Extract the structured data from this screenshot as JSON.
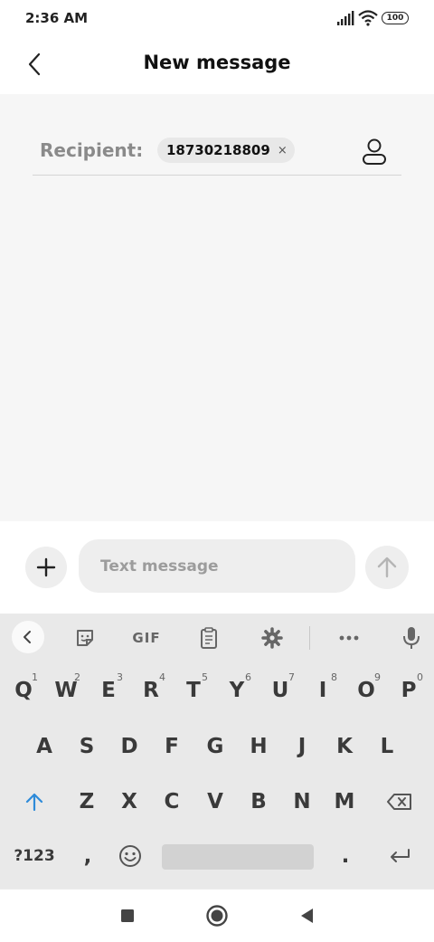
{
  "status_bar": {
    "time": "2:36 AM",
    "battery": "100",
    "icons": [
      "signal-icon",
      "wifi-icon",
      "battery-icon"
    ]
  },
  "header": {
    "title": "New message",
    "back_icon": "chevron-left-icon"
  },
  "recipient": {
    "label": "Recipient:",
    "chip_number": "18730218809",
    "chip_remove": "×",
    "contact_icon": "person-icon"
  },
  "compose": {
    "placeholder": "Text message",
    "value": "",
    "add_icon": "plus-icon",
    "send_icon": "arrow-up-icon"
  },
  "keyboard": {
    "toolbar": {
      "collapse_icon": "chevron-left-icon",
      "sticker_icon": "sticker-icon",
      "gif_label": "GIF",
      "clipboard_icon": "clipboard-icon",
      "settings_icon": "gear-icon",
      "more_icon": "more-icon",
      "mic_icon": "mic-icon"
    },
    "row1": [
      {
        "key": "Q",
        "sup": "1"
      },
      {
        "key": "W",
        "sup": "2"
      },
      {
        "key": "E",
        "sup": "3"
      },
      {
        "key": "R",
        "sup": "4"
      },
      {
        "key": "T",
        "sup": "5"
      },
      {
        "key": "Y",
        "sup": "6"
      },
      {
        "key": "U",
        "sup": "7"
      },
      {
        "key": "I",
        "sup": "8"
      },
      {
        "key": "O",
        "sup": "9"
      },
      {
        "key": "P",
        "sup": "0"
      }
    ],
    "row2": [
      "A",
      "S",
      "D",
      "F",
      "G",
      "H",
      "J",
      "K",
      "L"
    ],
    "row3": [
      "Z",
      "X",
      "C",
      "V",
      "B",
      "N",
      "M"
    ],
    "symbols_label": "?123",
    "comma": ",",
    "period": ".",
    "emoji_icon": "emoji-icon",
    "shift_icon": "shift-icon",
    "backspace_icon": "backspace-icon",
    "enter_icon": "enter-icon"
  },
  "nav_bar": {
    "icons": [
      "recents-icon",
      "home-icon",
      "back-icon"
    ]
  },
  "colors": {
    "content_bg": "#f6f6f6",
    "keyboard_bg": "#e9e9e9",
    "shift_accent": "#2e8bd9"
  }
}
